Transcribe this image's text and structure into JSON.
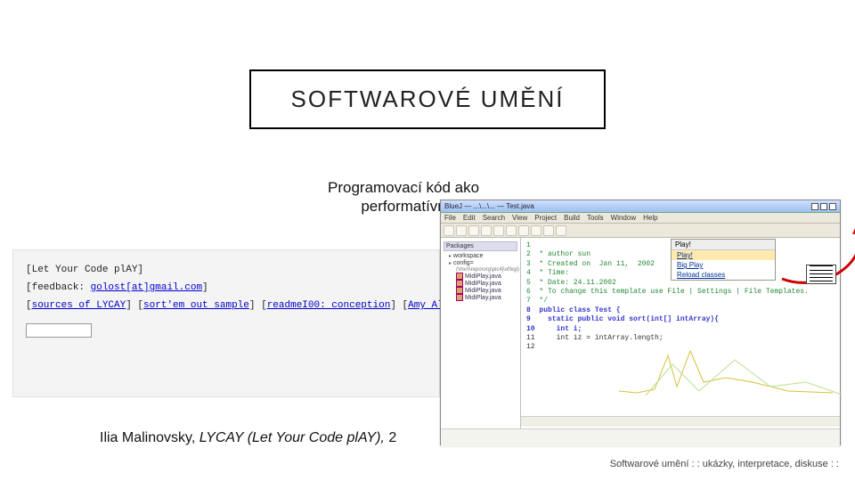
{
  "title": "SOFTWAROVÉ UMĚNÍ",
  "subtitle_line1": "Programovací kód ako",
  "subtitle_line2": "performatívn",
  "caption_author": "Ilia Malinovsky, ",
  "caption_work": "LYCAY (Let Your Code plAY), ",
  "caption_year": "2",
  "footer_topic": "Softwarové umění",
  "footer_desc": " : : ukázky, interpretace, diskuse : :",
  "left_image": {
    "line1": "[Let Your Code plAY]",
    "line2_prefix": "[feedback: ",
    "line2_mail": "golost[at]gmail.com",
    "line2_suffix": "]",
    "links": {
      "l1": "sources of LYCAY",
      "l2": "sort'em out sample",
      "l3": "readmeI00: conception",
      "l4": "Amy Alexander's text"
    }
  },
  "ide": {
    "titlebar": "BlueJ — ...\\...\\... — Test.java",
    "menu": [
      "File",
      "Edit",
      "Search",
      "View",
      "Project",
      "Build",
      "Tools",
      "Window",
      "Help"
    ],
    "sidebar_header": "Packages",
    "sidebar_root": "workspace",
    "sidebar_pkg": "config=",
    "sidebar_pkg_path": "(\\mvn\\repo\\org\\pic4j\\of\\kgi)",
    "sidebar_leaves": [
      "MidiPlay.java",
      "MidiPlay.java",
      "MidiPlay.java",
      "MidiPlay.java"
    ],
    "right_panel_title": "Play!",
    "right_items": [
      "Play!",
      "Big Play",
      "Reload classes"
    ],
    "code": {
      "l1": "1",
      "l2": "2  * author sun",
      "l3": "3  * Created on  Jan 11,  2002",
      "l4": "4  * Time: ",
      "l5": "5  * Date: 24.11.2002",
      "l6": "6  * To change this template use File | Settings | File Templates.",
      "l7": "7  */",
      "l8": "8  public class Test {",
      "l9": "9    static public void sort(int[] intArray){",
      "l10": "10     int i;",
      "l11": "11     int iz = intArray.length;",
      "l12": "12"
    }
  }
}
